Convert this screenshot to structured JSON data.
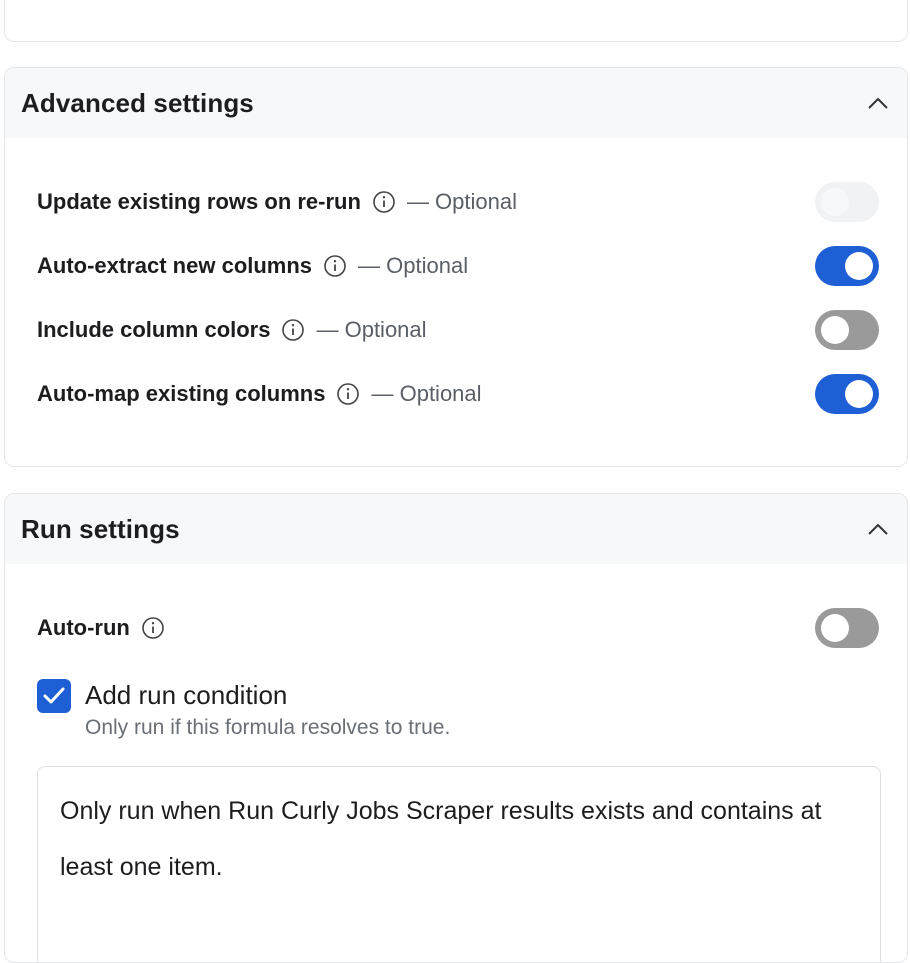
{
  "advanced": {
    "title": "Advanced settings",
    "rows": [
      {
        "label": "Update existing rows on re-run",
        "optional": "— Optional",
        "state": "disabled"
      },
      {
        "label": "Auto-extract new columns",
        "optional": "— Optional",
        "state": "on"
      },
      {
        "label": "Include column colors",
        "optional": "— Optional",
        "state": "off"
      },
      {
        "label": "Auto-map existing columns",
        "optional": "— Optional",
        "state": "on"
      }
    ]
  },
  "run": {
    "title": "Run settings",
    "auto_run": {
      "label": "Auto-run",
      "state": "off"
    },
    "condition": {
      "label": "Add run condition",
      "checked": true,
      "help": "Only run if this formula resolves to true.",
      "formula_value": "Only run when Run Curly Jobs Scraper results exists and contains at least one item."
    }
  },
  "colors": {
    "accent": "#1f5fd6",
    "toggle_off": "#9a9a9a",
    "toggle_disabled": "#f1f2f4",
    "header_bg": "#f7f8fa",
    "border": "#e4e6ea"
  },
  "icons": [
    "chevron-up-icon",
    "info-icon",
    "checkmark-icon"
  ]
}
